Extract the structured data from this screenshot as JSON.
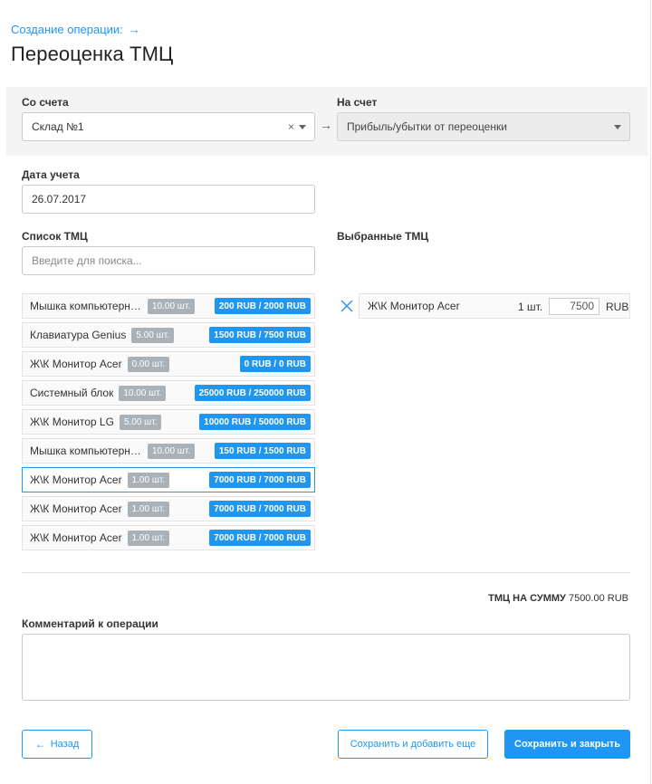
{
  "header": {
    "breadcrumb": "Создание операции:",
    "breadcrumb_arrow": "→",
    "title": "Переоценка ТМЦ"
  },
  "accounts": {
    "from_label": "Со счета",
    "from_value": "Склад №1",
    "to_label": "На счет",
    "to_value": "Прибыль/убытки от переоценки",
    "arrow": "→"
  },
  "date": {
    "label": "Дата учета",
    "value": "26.07.2017"
  },
  "list": {
    "label": "Список ТМЦ",
    "search_placeholder": "Введите для поиска...",
    "items": [
      {
        "name": "Мышка компьютерна…",
        "qty": "10.00 шт.",
        "price": "200 RUB / 2000 RUB"
      },
      {
        "name": "Клавиатура Genius",
        "qty": "5.00 шт.",
        "price": "1500 RUB / 7500 RUB"
      },
      {
        "name": "Ж\\К Монитор Acer",
        "qty": "0.00 шт.",
        "price": "0 RUB / 0 RUB"
      },
      {
        "name": "Системный блок",
        "qty": "10.00 шт.",
        "price": "25000 RUB / 250000 RUB"
      },
      {
        "name": "Ж\\К Монитор LG",
        "qty": "5.00 шт.",
        "price": "10000 RUB / 50000 RUB"
      },
      {
        "name": "Мышка компьютерна…",
        "qty": "10.00 шт.",
        "price": "150 RUB / 1500 RUB"
      },
      {
        "name": "Ж\\К Монитор Acer",
        "qty": "1.00 шт.",
        "price": "7000 RUB / 7000 RUB"
      },
      {
        "name": "Ж\\К Монитор Acer",
        "qty": "1.00 шт.",
        "price": "7000 RUB / 7000 RUB"
      },
      {
        "name": "Ж\\К Монитор Acer",
        "qty": "1.00 шт.",
        "price": "7000 RUB / 7000 RUB"
      }
    ]
  },
  "selected": {
    "label": "Выбранные ТМЦ",
    "items": [
      {
        "name": "Ж\\К Монитор Acer",
        "qty": "1 шт.",
        "amount": "7500",
        "currency": "RUB"
      }
    ]
  },
  "total": {
    "label": "ТМЦ НА СУММУ",
    "value": "7500.00 RUB"
  },
  "comment": {
    "label": "Комментарий к операции",
    "value": ""
  },
  "buttons": {
    "back": "Назад",
    "back_arrow": "←",
    "save_add": "Сохранить и добавить еще",
    "save_close": "Сохранить и закрыть"
  },
  "colors": {
    "accent": "#2196f3",
    "badge_gray": "#a9b1b9"
  }
}
